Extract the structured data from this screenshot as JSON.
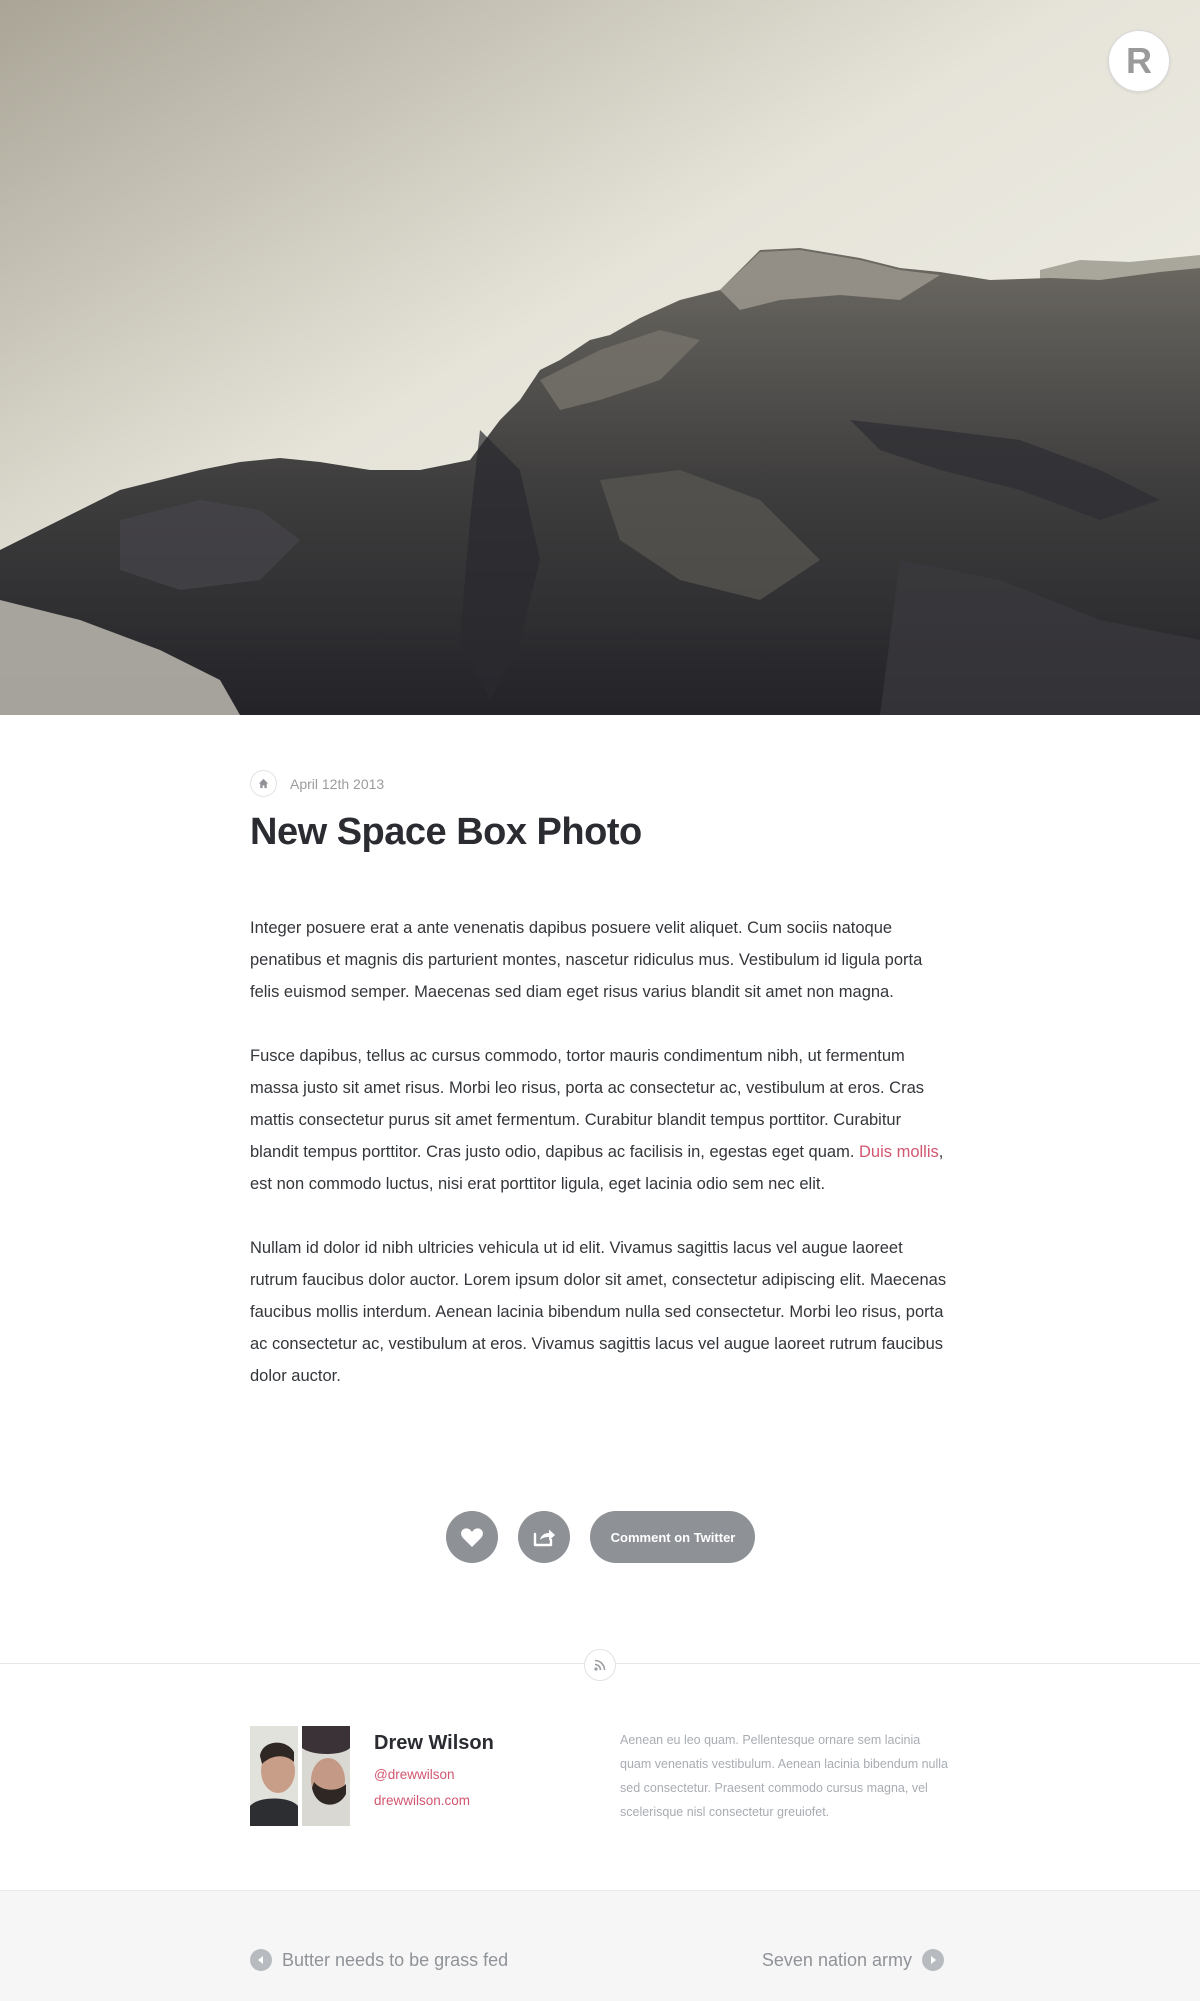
{
  "hero": {
    "alt": "Black and white photo of rugged mountain ridge",
    "logo_letter": "R"
  },
  "article": {
    "date": "April 12th 2013",
    "title": "New Space Box Photo",
    "paragraphs": [
      {
        "text": "Integer posuere erat a ante venenatis dapibus posuere velit aliquet. Cum sociis natoque penatibus et magnis dis parturient montes, nascetur ridiculus mus. Vestibulum id ligula porta felis euismod semper. Maecenas sed diam eget risus varius blandit sit amet non magna."
      },
      {
        "text_before": "Fusce dapibus, tellus ac cursus commodo, tortor mauris condimentum nibh, ut fermentum massa justo sit amet risus. Morbi leo risus, porta ac consectetur ac, vestibulum at eros. Cras mattis consectetur purus sit amet fermentum. Curabitur blandit tempus porttitor. Curabitur blandit tempus porttitor. Cras justo odio, dapibus ac facilisis in, egestas eget quam. ",
        "link": "Duis mollis",
        "text_after": ", est non commodo luctus, nisi erat porttitor ligula, eget lacinia odio sem nec elit."
      },
      {
        "text": "Nullam id dolor id nibh ultricies vehicula ut id elit. Vivamus sagittis lacus vel augue laoreet rutrum faucibus dolor auctor. Lorem ipsum dolor sit amet, consectetur adipiscing elit. Maecenas faucibus mollis interdum. Aenean lacinia bibendum nulla sed consectetur. Morbi leo risus, porta ac consectetur ac, vestibulum at eros. Vivamus sagittis lacus vel augue laoreet rutrum faucibus dolor auctor."
      }
    ]
  },
  "actions": {
    "like_icon": "heart-icon",
    "share_icon": "share-icon",
    "comment_label": "Comment on Twitter",
    "comment_icon": "speech-bubble-icon"
  },
  "feed": {
    "icon": "rss-icon"
  },
  "author": {
    "name": "Drew Wilson",
    "twitter": "@drewwilson",
    "website": "drewwilson.com",
    "bio": "Aenean eu leo quam. Pellentesque ornare sem lacinia quam venenatis vestibulum. Aenean lacinia bibendum nulla sed consectetur. Praesent commodo cursus magna, vel scelerisque nisl consectetur greuiofet."
  },
  "footer": {
    "prev_label": "Butter needs to be grass fed",
    "next_label": "Seven nation army"
  },
  "colors": {
    "accent": "#d2566f",
    "button_gray": "#8e9195",
    "title": "#2a2c31"
  }
}
